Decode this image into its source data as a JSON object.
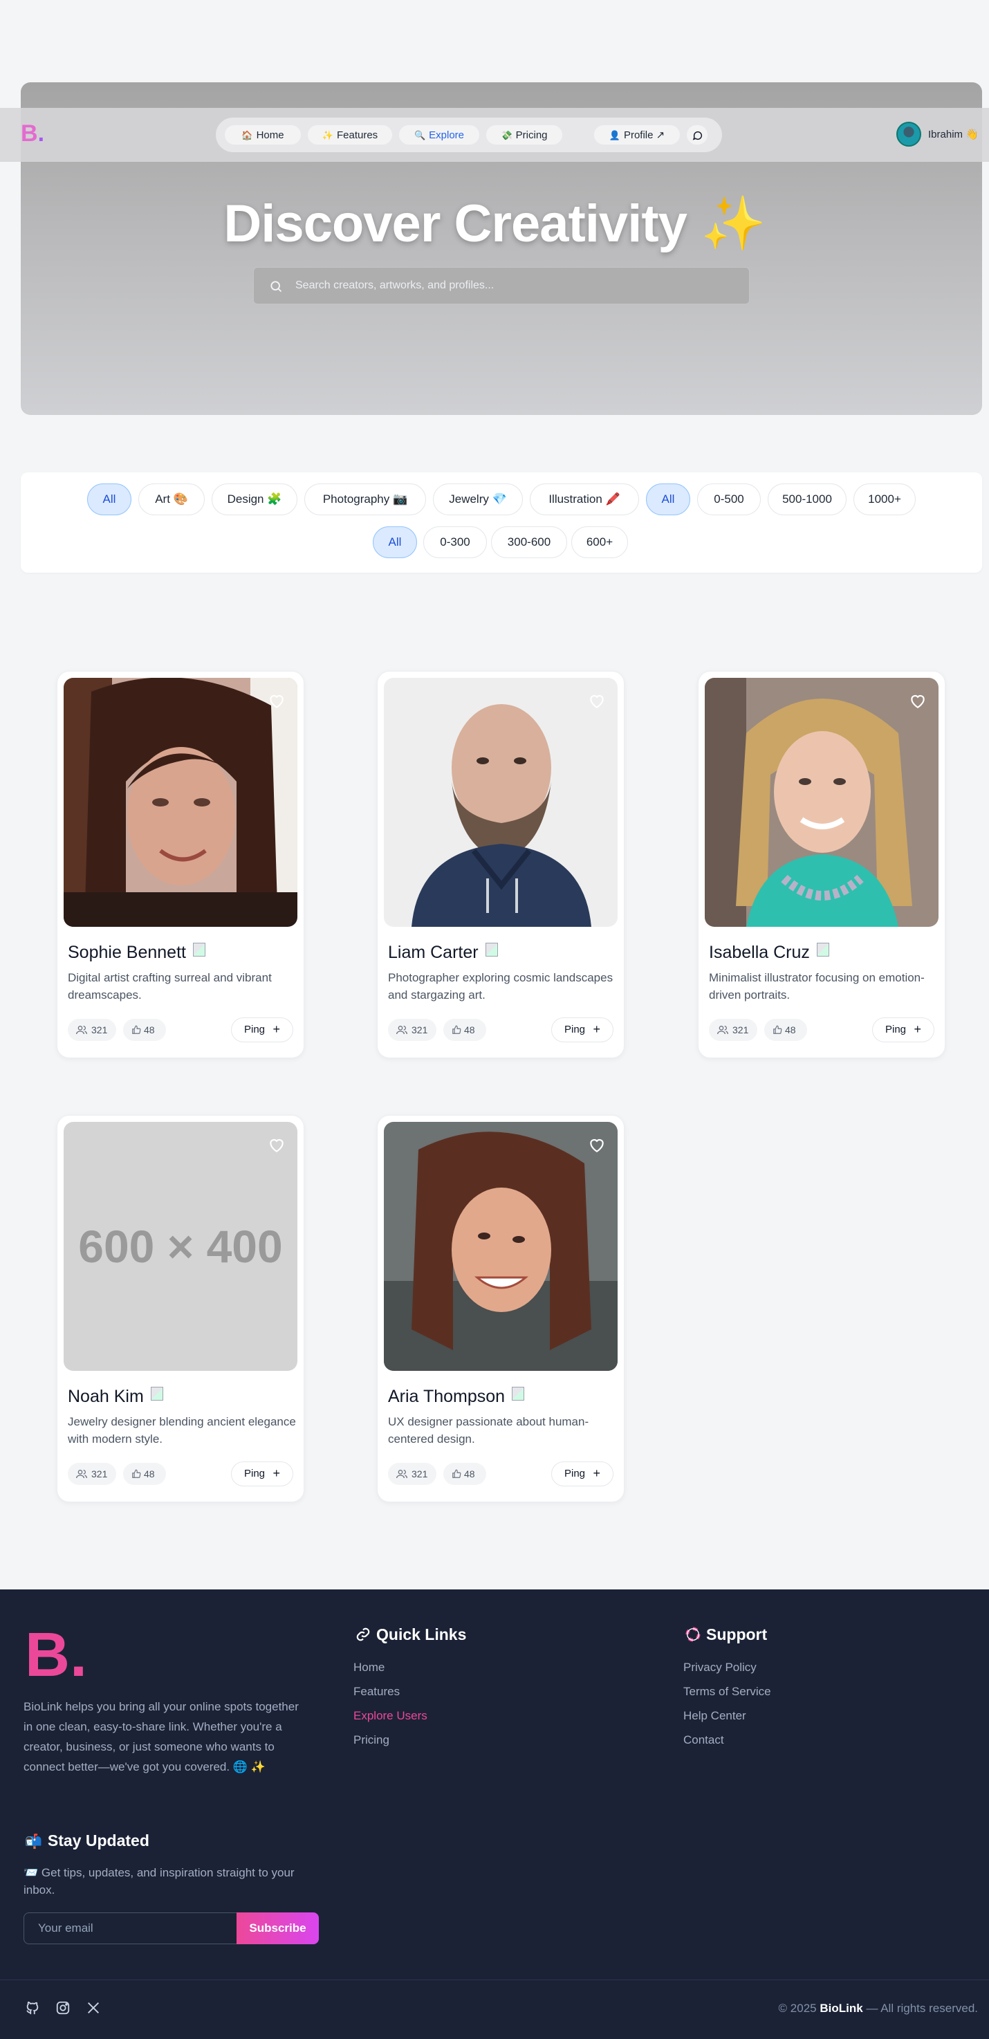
{
  "brand": {
    "logo_letter": "B",
    "logo_dot": "."
  },
  "nav": {
    "items": [
      {
        "icon": "🏠",
        "label": "Home"
      },
      {
        "icon": "✨",
        "label": "Features"
      },
      {
        "icon": "🔍",
        "label": "Explore"
      },
      {
        "icon": "💸",
        "label": "Pricing"
      }
    ],
    "profile": {
      "icon": "👤",
      "label": "Profile",
      "arrow": "↗"
    },
    "user_name": "Ibrahim 👋"
  },
  "hero": {
    "title": "Discover Creativity",
    "title_emoji": "✨",
    "search_placeholder": "Search creators, artworks, and profiles..."
  },
  "filters": {
    "categories": [
      "All",
      "Art 🎨",
      "Design 🧩",
      "Photography 📷",
      "Jewelry 💎",
      "Illustration 🖍️"
    ],
    "followers": [
      "All",
      "0-500",
      "500-1000",
      "1000+"
    ],
    "price": [
      "All",
      "0-300",
      "300-600",
      "600+"
    ]
  },
  "creators": [
    {
      "name": "Sophie Bennett",
      "bio": "Digital artist crafting surreal and vibrant dreamscapes.",
      "followers": "321",
      "likes": "48",
      "ping": "Ping"
    },
    {
      "name": "Liam Carter",
      "bio": "Photographer exploring cosmic landscapes and stargazing art.",
      "followers": "321",
      "likes": "48",
      "ping": "Ping"
    },
    {
      "name": "Isabella Cruz",
      "bio": "Minimalist illustrator focusing on emotion-driven portraits.",
      "followers": "321",
      "likes": "48",
      "ping": "Ping"
    },
    {
      "name": "Noah Kim",
      "bio": "Jewelry designer blending ancient elegance with modern style.",
      "followers": "321",
      "likes": "48",
      "ping": "Ping",
      "placeholder_text": "600 × 400"
    },
    {
      "name": "Aria Thompson",
      "bio": "UX designer passionate about human-centered design.",
      "followers": "321",
      "likes": "48",
      "ping": "Ping"
    }
  ],
  "footer": {
    "about": "BioLink helps you bring all your online spots together in one clean, easy-to-share link. Whether you're a creator, business, or just someone who wants to connect better—we've got you covered. 🌐 ✨",
    "quick_links_title": "Quick Links",
    "quick_links": [
      "Home",
      "Features",
      "Explore Users",
      "Pricing"
    ],
    "support_title": "Support",
    "support_links": [
      "Privacy Policy",
      "Terms of Service",
      "Help Center",
      "Contact"
    ],
    "stay_title": "Stay Updated",
    "stay_text": "📨 Get tips, updates, and inspiration straight to your inbox.",
    "email_placeholder": "Your email",
    "subscribe_label": "Subscribe",
    "copyright_prefix": "© 2025",
    "copyright_brand": "BioLink",
    "copyright_suffix": "— All rights reserved."
  },
  "colors": {
    "accent_pink": "#ec4899",
    "active_blue": "#2563eb",
    "footer_bg": "#1b2236"
  }
}
